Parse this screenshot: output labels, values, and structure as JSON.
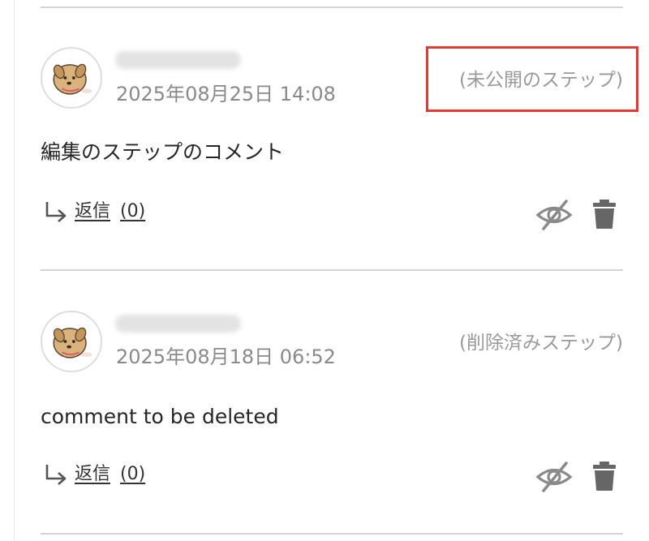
{
  "comments": [
    {
      "timestamp": "2025年08月25日 14:08",
      "step_status": "(未公開のステップ)",
      "body": "編集のステップのコメント",
      "reply_label": "返信",
      "reply_count": "(0)"
    },
    {
      "timestamp": "2025年08月18日 06:52",
      "step_status": "(削除済みステップ)",
      "body": "comment to be deleted",
      "reply_label": "返信",
      "reply_count": "(0)"
    }
  ],
  "icons": {
    "reply": "reply-arrow-icon",
    "hide": "eye-slash-icon",
    "delete": "trash-icon"
  },
  "colors": {
    "highlight": "#e53935",
    "icon_gray": "#8a8a8a"
  }
}
